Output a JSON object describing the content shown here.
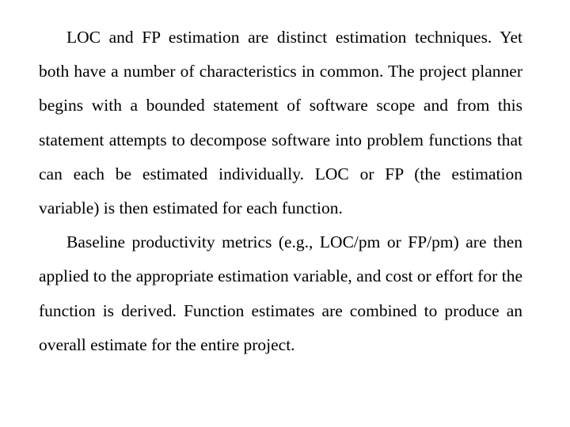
{
  "document": {
    "paragraphs": [
      "LOC and FP estimation are distinct estimation techniques. Yet both have a number of characteristics in common. The project planner begins with a bounded statement of software scope and from this statement attempts to decompose software into problem functions that can each be estimated individually. LOC or FP (the estimation variable) is then estimated for each function.",
      "Baseline productivity metrics (e.g., LOC/pm or FP/pm) are then applied to the appropriate estimation variable, and cost or effort for the function is derived. Function estimates are combined to produce an overall estimate for the entire project."
    ]
  }
}
